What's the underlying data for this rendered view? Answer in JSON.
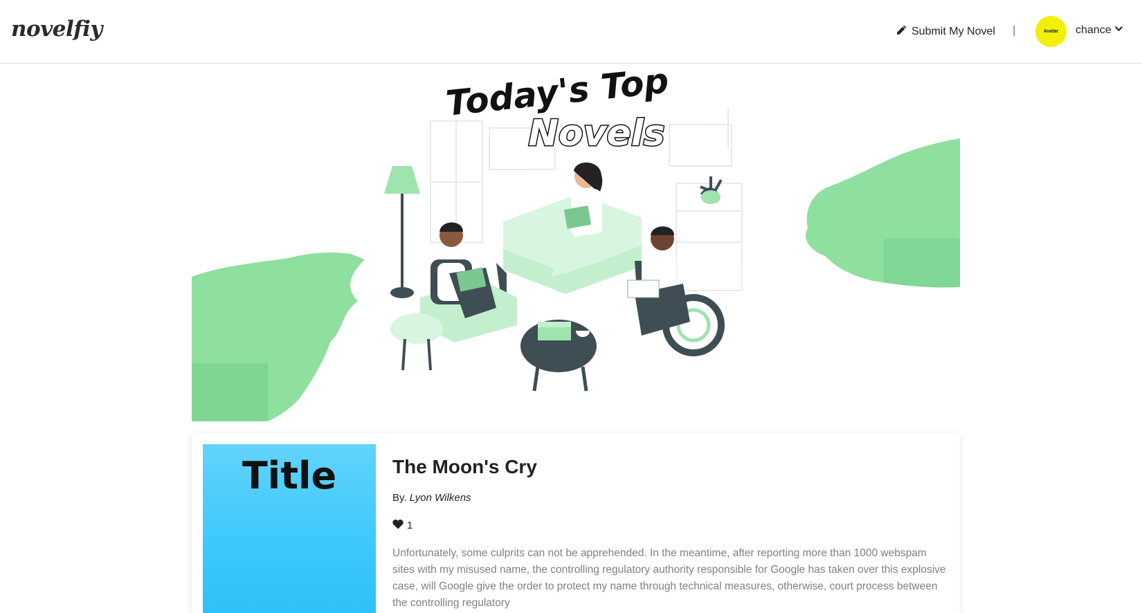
{
  "header": {
    "logo": "novelfiy",
    "submit_label": "Submit My Novel",
    "separator": "|",
    "avatar_text": "Avatar",
    "avatar_color": "#f0f00a",
    "username": "chance"
  },
  "banner": {
    "line1": "Today's Top",
    "line2": "Novels",
    "accent_color": "#86dd9c"
  },
  "novel": {
    "cover_text": "Title",
    "title": "The Moon's Cry",
    "by_prefix": "By.",
    "author": "Lyon Wilkens",
    "likes": "1",
    "summary": "Unfortunately, some culprits can not be apprehended. In the meantime, after reporting more than 1000 webspam sites with my misused name, the controlling regulatory authority responsible for Google has taken over this explosive case, will Google give the order to protect my name through technical measures, otherwise, court process between the controlling regulatory"
  }
}
